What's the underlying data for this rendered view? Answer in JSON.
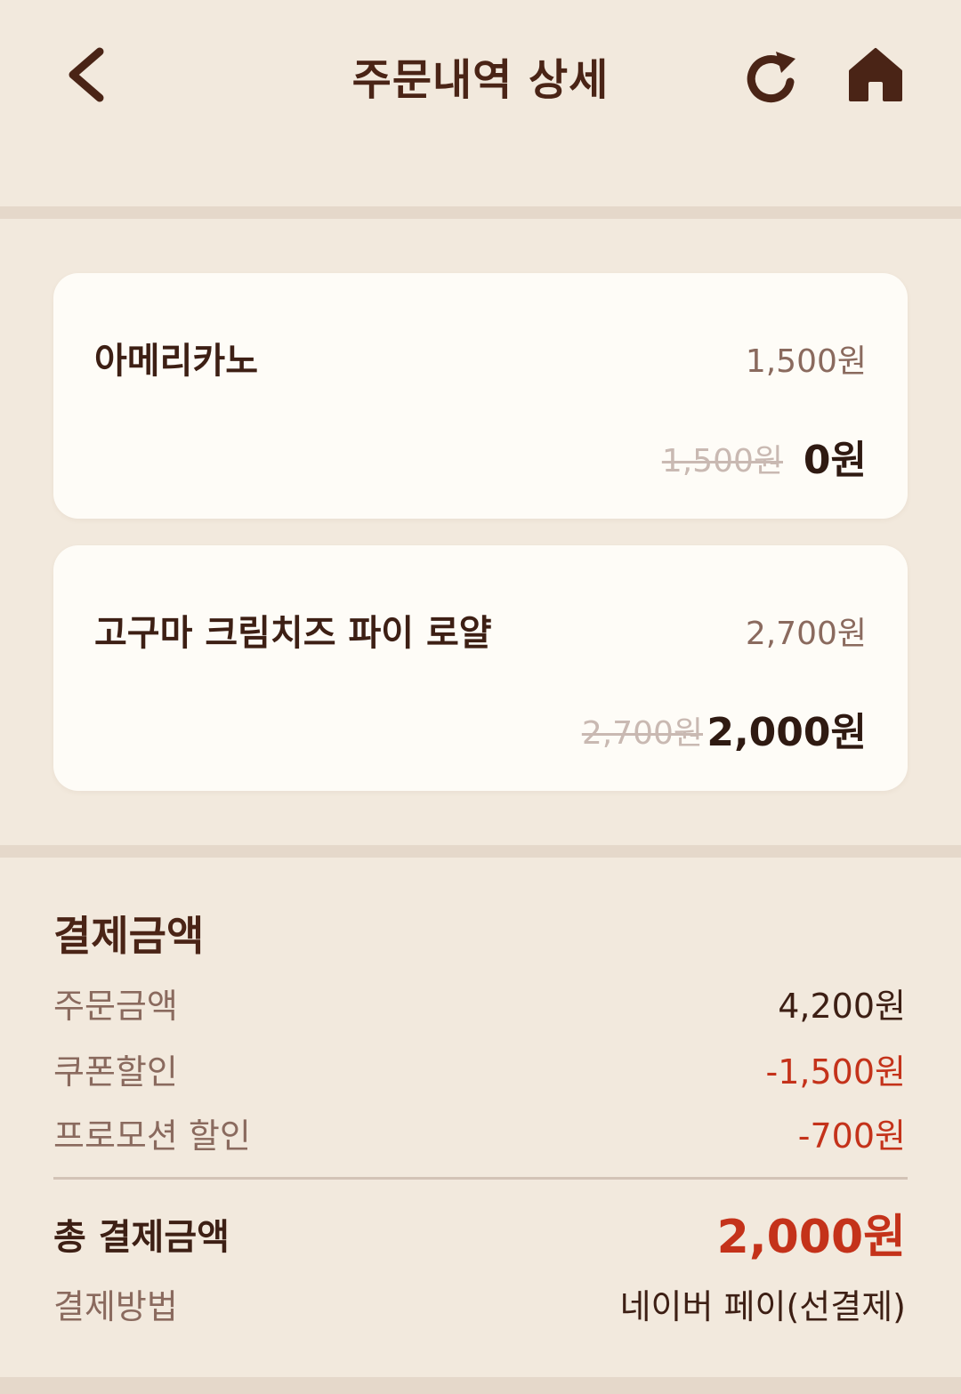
{
  "header": {
    "title": "주문내역 상세",
    "icons": [
      "back-chevron-icon",
      "refresh-icon",
      "home-icon"
    ]
  },
  "items": [
    {
      "name": "아메리카노",
      "price": "1,500원",
      "original_price": "1,500원",
      "final_price": "0원"
    },
    {
      "name": "고구마 크림치즈 파이 로얄",
      "price": "2,700원",
      "original_price": "2,700원",
      "final_price": "2,000원"
    }
  ],
  "payment": {
    "title": "결제금액",
    "order_amount_label": "주문금액",
    "order_amount_value": "4,200원",
    "coupon_label": "쿠폰할인",
    "coupon_value": "-1,500원",
    "promo_label": "프로모션 할인",
    "promo_value": "-700원",
    "total_label": "총 결제금액",
    "total_value": "2,000원",
    "method_label": "결제방법",
    "method_value": "네이버 페이(선결제)"
  },
  "colors": {
    "background": "#f2e9dd",
    "card": "#fefcf7",
    "text_dark": "#4a2416",
    "accent_red": "#c4321a",
    "muted": "#8a6a5e"
  }
}
